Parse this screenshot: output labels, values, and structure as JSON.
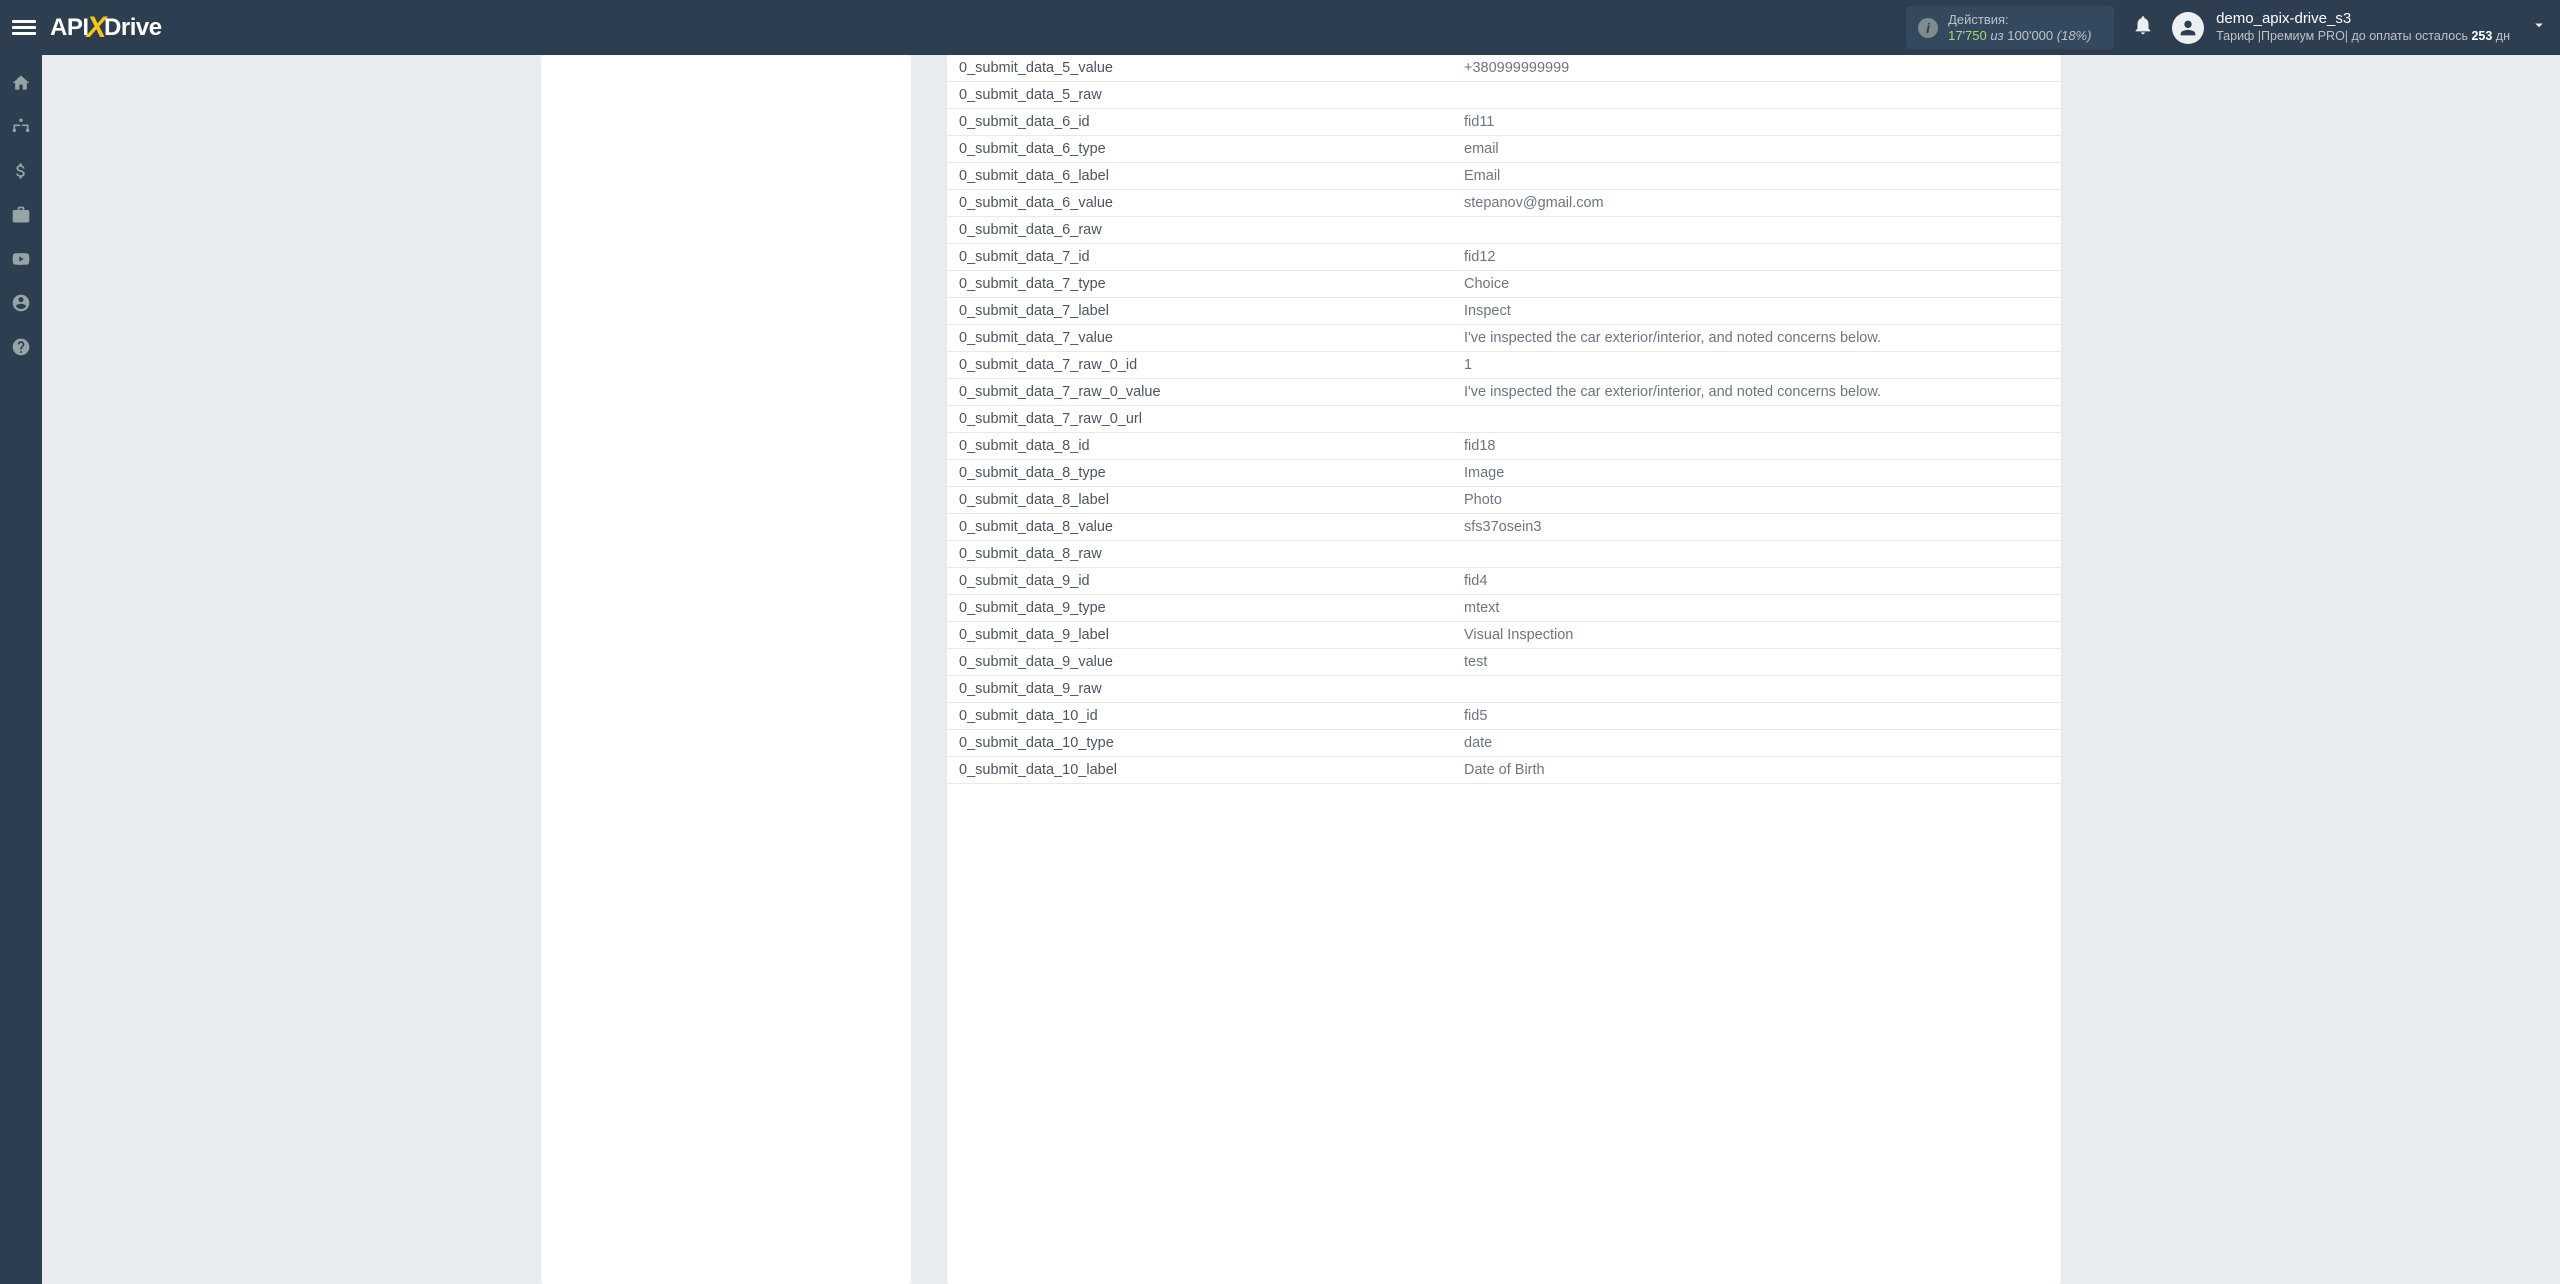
{
  "header": {
    "logo_pre": "API",
    "logo_x": "X",
    "logo_post": "Drive",
    "actions_label": "Действия:",
    "actions_used": "17'750",
    "actions_of": "из",
    "actions_total": "100'000",
    "actions_percent": "(18%)",
    "user_name": "demo_apix-drive_s3",
    "tariff_prefix": "Тариф |Премиум PRO| до оплаты осталось ",
    "tariff_days": "253",
    "tariff_suffix": " дн"
  },
  "rows": [
    {
      "key": "0_submit_data_5_value",
      "val": "+380999999999"
    },
    {
      "key": "0_submit_data_5_raw",
      "val": ""
    },
    {
      "key": "0_submit_data_6_id",
      "val": "fid11"
    },
    {
      "key": "0_submit_data_6_type",
      "val": "email"
    },
    {
      "key": "0_submit_data_6_label",
      "val": "Email"
    },
    {
      "key": "0_submit_data_6_value",
      "val": "stepanov@gmail.com"
    },
    {
      "key": "0_submit_data_6_raw",
      "val": ""
    },
    {
      "key": "0_submit_data_7_id",
      "val": "fid12"
    },
    {
      "key": "0_submit_data_7_type",
      "val": "Choice"
    },
    {
      "key": "0_submit_data_7_label",
      "val": "Inspect"
    },
    {
      "key": "0_submit_data_7_value",
      "val": "I've inspected the car exterior/interior, and noted concerns below."
    },
    {
      "key": "0_submit_data_7_raw_0_id",
      "val": "1"
    },
    {
      "key": "0_submit_data_7_raw_0_value",
      "val": "I've inspected the car exterior/interior, and noted concerns below."
    },
    {
      "key": "0_submit_data_7_raw_0_url",
      "val": ""
    },
    {
      "key": "0_submit_data_8_id",
      "val": "fid18"
    },
    {
      "key": "0_submit_data_8_type",
      "val": "Image"
    },
    {
      "key": "0_submit_data_8_label",
      "val": "Photo"
    },
    {
      "key": "0_submit_data_8_value",
      "val": "sfs37osein3"
    },
    {
      "key": "0_submit_data_8_raw",
      "val": ""
    },
    {
      "key": "0_submit_data_9_id",
      "val": "fid4"
    },
    {
      "key": "0_submit_data_9_type",
      "val": "mtext"
    },
    {
      "key": "0_submit_data_9_label",
      "val": "Visual Inspection"
    },
    {
      "key": "0_submit_data_9_value",
      "val": "test"
    },
    {
      "key": "0_submit_data_9_raw",
      "val": ""
    },
    {
      "key": "0_submit_data_10_id",
      "val": "fid5"
    },
    {
      "key": "0_submit_data_10_type",
      "val": "date"
    },
    {
      "key": "0_submit_data_10_label",
      "val": "Date of Birth"
    }
  ]
}
